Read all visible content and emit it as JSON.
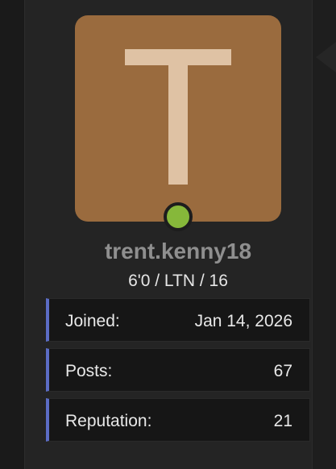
{
  "profile": {
    "avatar_letter": "T",
    "avatar_color": "#9a6b3e",
    "avatar_letter_color": "#dfc2a4",
    "status": "online",
    "status_color": "#86b83a",
    "username": "trent.kenny18",
    "subtitle": "6'0 / LTN / 16"
  },
  "stats": [
    {
      "label": "Joined:",
      "value": "Jan 14, 2026"
    },
    {
      "label": "Posts:",
      "value": "67"
    },
    {
      "label": "Reputation:",
      "value": "21"
    }
  ],
  "accent_color": "#5b6cc4"
}
